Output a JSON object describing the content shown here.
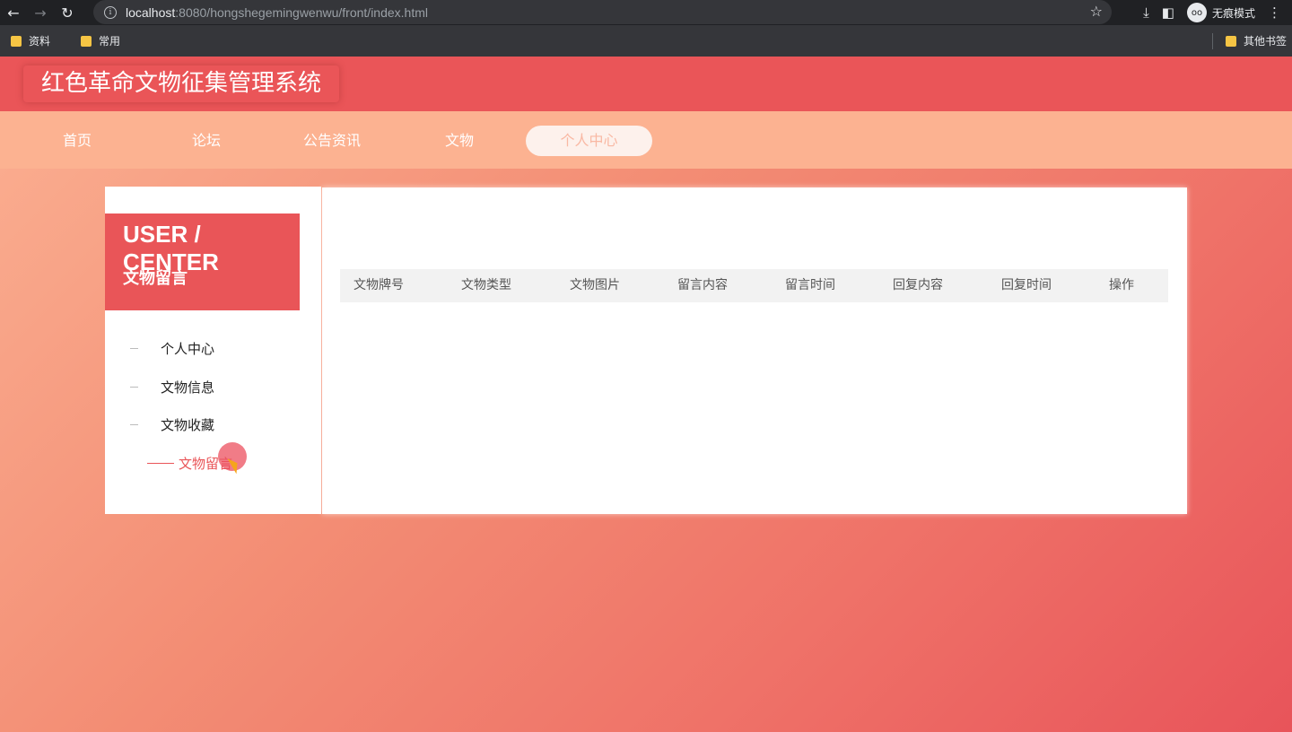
{
  "browser": {
    "url_host": "localhost",
    "url_path": ":8080/hongshegemingwenwu/front/index.html",
    "incognito_label": "无痕模式",
    "bookmarks": [
      "资料",
      "常用"
    ],
    "other_bookmarks": "其他书签"
  },
  "site": {
    "title": "红色革命文物征集管理系统"
  },
  "topnav": {
    "items": [
      "首页",
      "论坛",
      "公告资讯",
      "文物",
      "个人中心"
    ],
    "active": "个人中心"
  },
  "sidebar": {
    "title": "USER / CENTER",
    "subtitle": "文物留言",
    "items": [
      "个人中心",
      "文物信息",
      "文物收藏",
      "文物留言"
    ]
  },
  "table": {
    "headers": [
      "文物牌号",
      "文物类型",
      "文物图片",
      "留言内容",
      "留言时间",
      "回复内容",
      "回复时间",
      "操作"
    ]
  },
  "colors": {
    "header": "#ea5558",
    "nav": "#fcb291",
    "accent": "#e95558"
  }
}
